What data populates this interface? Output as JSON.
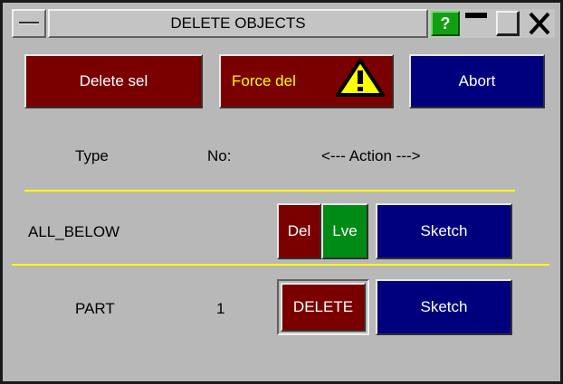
{
  "window": {
    "title": "DELETE OBJECTS",
    "help_label": "?"
  },
  "actions": {
    "delete_sel": "Delete sel",
    "force_del": "Force del",
    "abort": "Abort"
  },
  "table": {
    "headers": {
      "type": "Type",
      "no": "No:",
      "action": "<--- Action --->"
    },
    "rows": [
      {
        "type": "ALL_BELOW",
        "no": "",
        "del_label": "Del",
        "lve_label": "Lve",
        "sketch_label": "Sketch"
      },
      {
        "type": "PART",
        "no": "1",
        "delete_label": "DELETE",
        "sketch_label": "Sketch"
      }
    ]
  },
  "colors": {
    "panel_bg": "#b8b8b8",
    "dark_red": "#7a0000",
    "navy": "#00007f",
    "green": "#008a16",
    "separator": "#ffff00",
    "warning_yellow": "#ffff00"
  },
  "icons": {
    "system_menu": "system-menu-icon",
    "help": "help-icon",
    "minimize": "minimize-icon",
    "maximize": "maximize-icon",
    "close": "close-icon",
    "warning": "warning-icon"
  }
}
